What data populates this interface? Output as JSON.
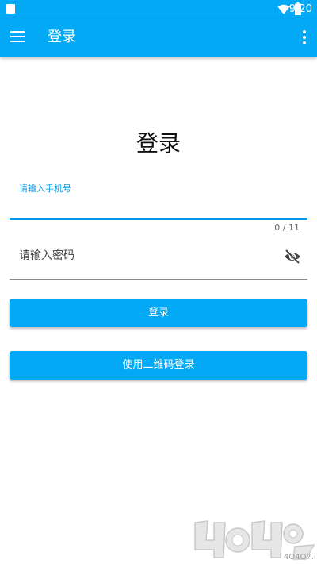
{
  "status_bar": {
    "time": "9:20",
    "icons": [
      "notification-square-icon",
      "wifi-icon",
      "battery-icon"
    ]
  },
  "app_bar": {
    "title": "登录",
    "menu_icon": "hamburger-menu-icon",
    "overflow_icon": "more-vert-icon"
  },
  "form": {
    "heading": "登录",
    "phone": {
      "label": "请输入手机号",
      "value": "",
      "counter": "0 / 11"
    },
    "password": {
      "placeholder": "请输入密码",
      "value": "",
      "toggle_icon": "visibility-off-icon"
    },
    "login_button": "登录",
    "qr_login_button": "使用二维码登录"
  },
  "watermark": {
    "text": "4O4O7.com"
  },
  "colors": {
    "primary": "#03A9F4",
    "accent": "#039BE5",
    "background": "#FFFFFF"
  }
}
